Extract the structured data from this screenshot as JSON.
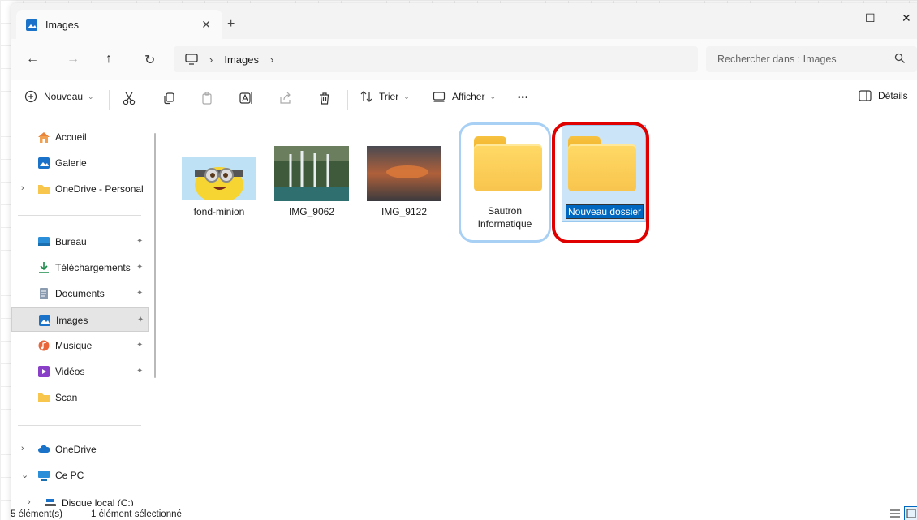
{
  "window": {
    "tab_title": "Images",
    "tab_close": "✕",
    "new_tab": "+",
    "minimize": "—",
    "maximize": "☐",
    "close": "✕"
  },
  "nav": {
    "back": "←",
    "forward": "→",
    "up": "↑",
    "refresh": "↻",
    "breadcrumb_sep": "›",
    "breadcrumb": [
      "Images"
    ],
    "search_placeholder": "Rechercher dans : Images"
  },
  "toolbar": {
    "new_label": "Nouveau",
    "sort_label": "Trier",
    "view_label": "Afficher",
    "more_label": "•••",
    "details_label": "Détails",
    "chevron": "⌄"
  },
  "sidebar": {
    "quick": [
      {
        "label": "Accueil",
        "icon": "home-icon"
      },
      {
        "label": "Galerie",
        "icon": "gallery-icon"
      },
      {
        "label": "OneDrive - Personal",
        "icon": "folder-icon"
      }
    ],
    "pinned": [
      {
        "label": "Bureau",
        "icon": "desktop-icon"
      },
      {
        "label": "Téléchargements",
        "icon": "download-icon"
      },
      {
        "label": "Documents",
        "icon": "documents-icon"
      },
      {
        "label": "Images",
        "icon": "pictures-icon"
      },
      {
        "label": "Musique",
        "icon": "music-icon"
      },
      {
        "label": "Vidéos",
        "icon": "videos-icon"
      },
      {
        "label": "Scan",
        "icon": "folder-icon"
      }
    ],
    "drives": [
      {
        "label": "OneDrive",
        "icon": "cloud-icon"
      },
      {
        "label": "Ce PC",
        "icon": "pc-icon"
      },
      {
        "label": "Disque local (C:)",
        "icon": "drive-icon"
      }
    ],
    "pin_glyph": "📌",
    "expand_glyph": "›",
    "collapse_glyph": "⌄"
  },
  "content": {
    "items": [
      {
        "label": "fond-minion",
        "type": "image"
      },
      {
        "label": "IMG_9062",
        "type": "image"
      },
      {
        "label": "IMG_9122",
        "type": "image"
      },
      {
        "label": "Sautron Informatique",
        "label_line1": "Sautron",
        "label_line2": "Informatique",
        "type": "folder"
      },
      {
        "label": "Nouveau dossier",
        "type": "folder",
        "state": "renaming"
      }
    ]
  },
  "status": {
    "count": "5 élément(s)",
    "selection": "1 élément sélectionné"
  },
  "colors": {
    "accent": "#0067c0",
    "highlight_blue": "#a8d0f5",
    "highlight_red": "#e10000",
    "folder": "#f8c54d"
  }
}
